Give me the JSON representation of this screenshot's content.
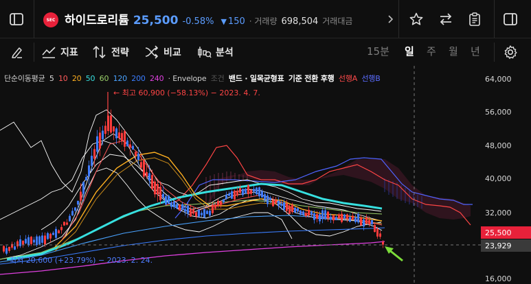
{
  "header": {
    "stock_badge": "SEC",
    "stock_name": "하이드로리튬",
    "price": "25,500",
    "change_pct": "-0.58%",
    "change_arrow": "▼",
    "change_abs": "150",
    "volume_label": "· 거래량",
    "volume_value": "698,504",
    "amount_label": "거래대금",
    "colors": {
      "price": "#5b9cff",
      "down": "#5b9cff",
      "badge": "#e8213a"
    }
  },
  "toolbar": {
    "indicator_label": "지표",
    "strategy_label": "전략",
    "compare_label": "비교",
    "analysis_label": "분석",
    "periods": [
      "15분",
      "일",
      "주",
      "월",
      "년"
    ],
    "active_period": "일"
  },
  "legend": {
    "ma_label": "단순이동평균",
    "ma_periods": [
      {
        "value": "5",
        "color": "#dcdcdc"
      },
      {
        "value": "10",
        "color": "#ff5a5a"
      },
      {
        "value": "20",
        "color": "#ffb020"
      },
      {
        "value": "50",
        "color": "#37e0e0"
      },
      {
        "value": "60",
        "color": "#9cd26a"
      },
      {
        "value": "120",
        "color": "#4aa3ff"
      },
      {
        "value": "200",
        "color": "#3a7dff"
      },
      {
        "value": "240",
        "color": "#e040e0"
      }
    ],
    "envelope_label": "· Envelope",
    "conditional_label": "조건",
    "band_label": "밴드 · 일목균형표",
    "ichimoku_items": "기준 전환 후행",
    "span_a_label": "선행A",
    "span_b_label": "선행B",
    "colors": {
      "span_a": "#ff4a4a",
      "span_b": "#5a6cff"
    }
  },
  "annotations": {
    "high": "← 최고 60,900 (−58.13%) − 2023. 4. 7.",
    "low": "최저 20,600 (+23.79%) − 2023. 2. 24."
  },
  "price_axis": {
    "ticks": [
      "64,000",
      "56,000",
      "48,000",
      "40,000",
      "32,000",
      "16,000"
    ],
    "current_price": "25,500",
    "cursor_price": "23,929",
    "colors": {
      "current_bg": "#e8213a",
      "cursor_bg": "#3a3a3a"
    }
  },
  "chart_data": {
    "type": "candlestick",
    "high_value": 60900,
    "low_value": 20600,
    "last_close": 25500,
    "cursor_value": 23929
  }
}
